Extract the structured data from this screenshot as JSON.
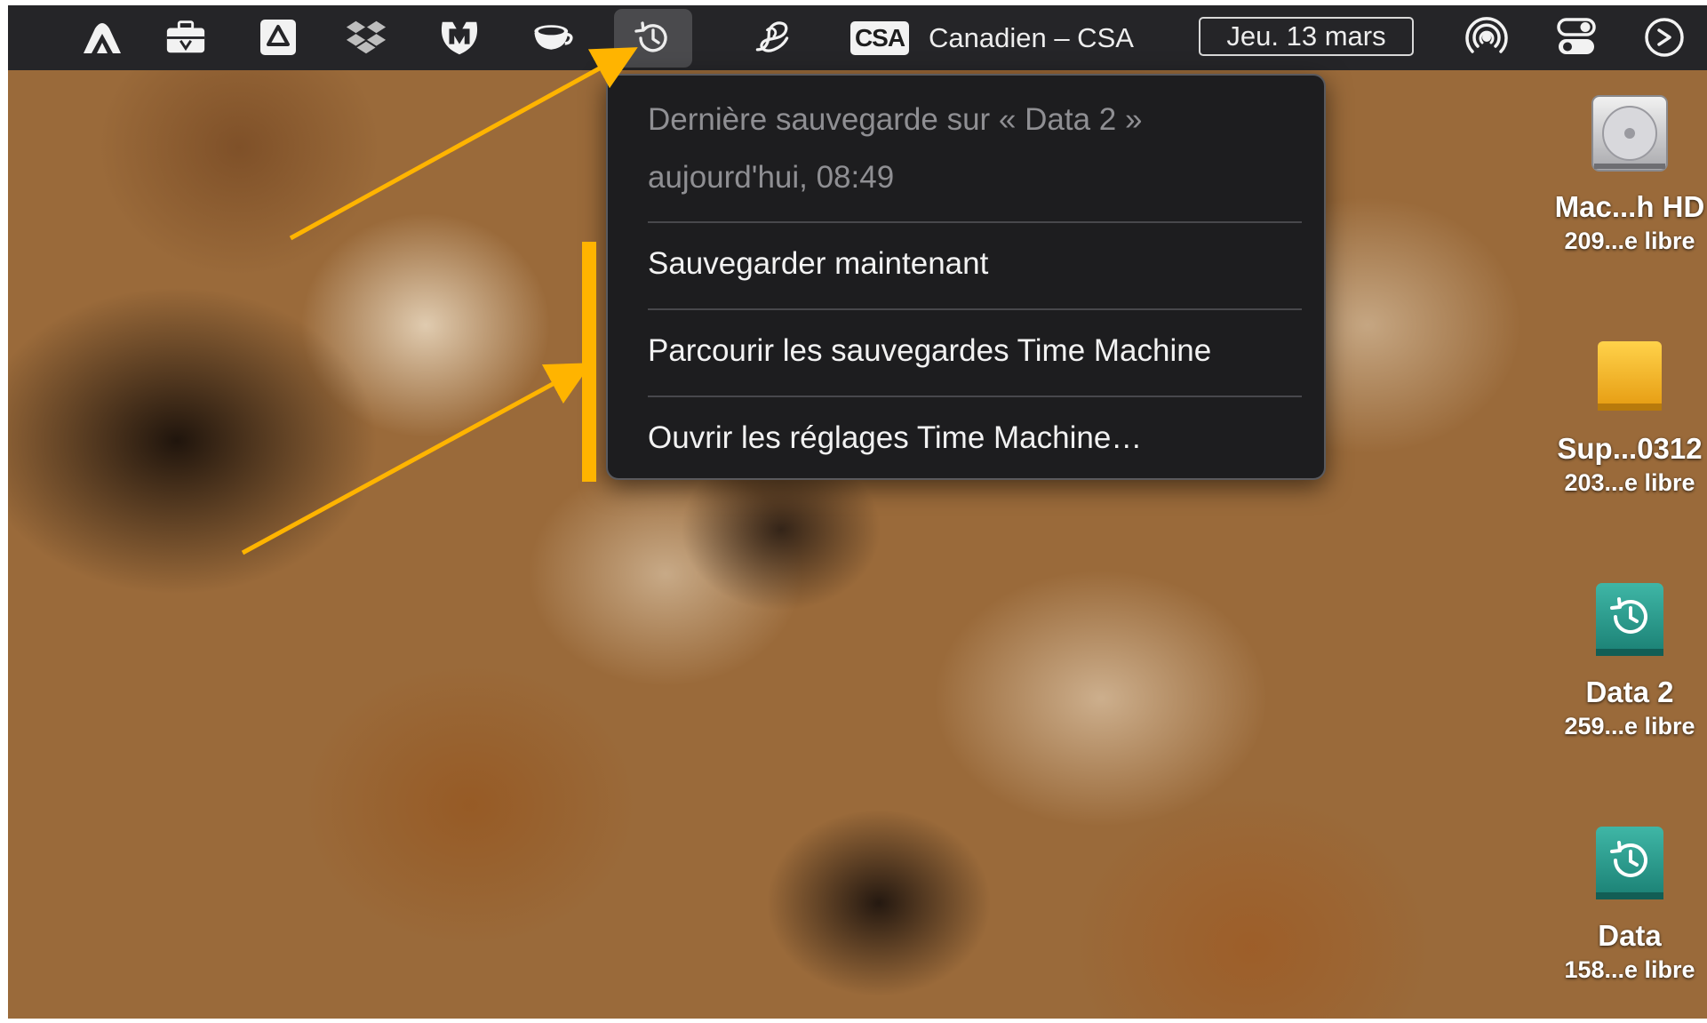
{
  "menubar": {
    "icons": [
      "nordvpn-icon",
      "toolbox-icon",
      "drive-icon",
      "dropbox-icon",
      "malwarebytes-icon",
      "coffee-icon",
      "time-machine-icon",
      "script-icon",
      "wifi-broadcast-icon",
      "control-center-icon",
      "siri-icon"
    ],
    "keyboard_badge": "CSA",
    "keyboard_label": "Canadien – CSA",
    "date": "Jeu. 13 mars"
  },
  "time_machine_menu": {
    "status_line1": "Dernière sauvegarde sur « Data 2 »",
    "status_line2": "aujourd'hui, 08:49",
    "items": [
      {
        "label": "Sauvegarder maintenant"
      },
      {
        "label": "Parcourir les sauvegardes Time Machine"
      },
      {
        "label": "Ouvrir les réglages Time Machine…"
      }
    ]
  },
  "annotation": {
    "color": "#ffb400"
  },
  "desktop_icons": [
    {
      "name": "Mac...h HD",
      "sub": "209...e libre",
      "icon": "internal-drive-icon"
    },
    {
      "name": "Sup...0312",
      "sub": "203...e libre",
      "icon": "external-drive-icon"
    },
    {
      "name": "Data 2",
      "sub": "259...e libre",
      "icon": "time-machine-drive-icon"
    },
    {
      "name": "Data",
      "sub": "158...e libre",
      "icon": "time-machine-drive-icon"
    }
  ]
}
